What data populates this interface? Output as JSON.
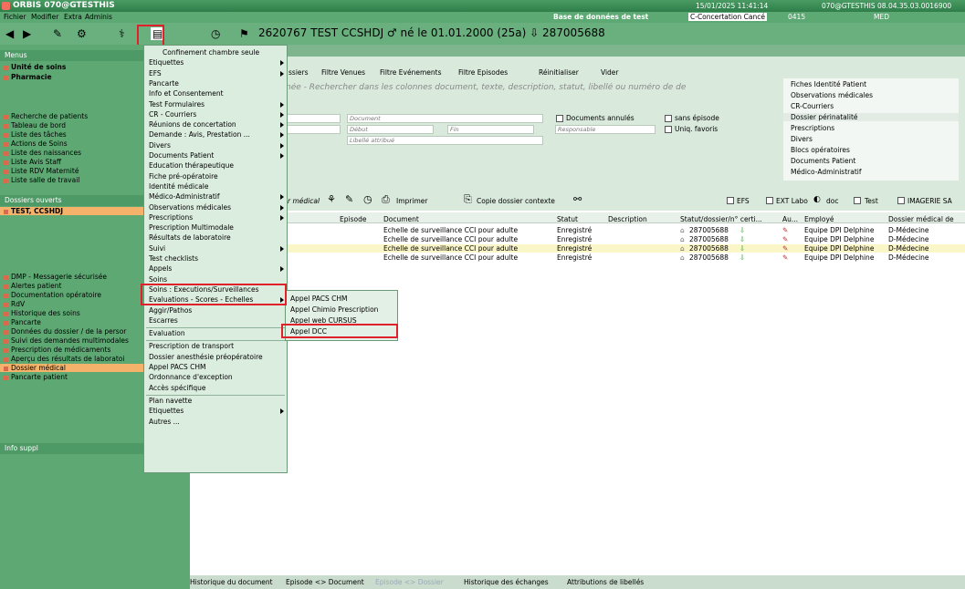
{
  "window": {
    "title": "ORBIS 070@GTESTHIS",
    "datetime": "15/01/2025 11:41:14",
    "session": "070@GTESTHIS 08.04.35.03.0016900"
  },
  "menubar": {
    "items": [
      "Fichier",
      "Modifier",
      "Extra",
      "Adminis"
    ],
    "db_label": "Base de données de test",
    "context": "C-Concertation Cancé",
    "code": "0415",
    "med": "MED"
  },
  "patient": {
    "text": "2620767  TEST CCSHDJ ♂ né le 01.01.2000  (25a)  ⇩ 287005688"
  },
  "left": {
    "menus_header": "Menus",
    "top_items": [
      "Unité de soins",
      "Pharmacie"
    ],
    "nav_items": [
      "Recherche de patients",
      "Tableau de bord",
      "Liste des tâches",
      "Actions de Soins",
      "Liste des naissances",
      "Liste Avis Staff",
      "Liste RDV Maternité",
      "Liste salle de travail"
    ],
    "dossiers_header": "Dossiers ouverts",
    "dossier": "TEST, CCSHDJ",
    "bottom_items": [
      "DMP - Messagerie sécurisée",
      "Alertes patient",
      "Documentation opératoire",
      "RdV",
      "Historique des soins",
      "Pancarte",
      "Données du dossier / de la persor",
      "Suivi des demandes multimodales",
      "Prescription de médicaments",
      "Aperçu des résultats de laboratoi",
      "Dossier médical",
      "Pancarte patient"
    ],
    "info_header": "Info suppl"
  },
  "tabs": [
    "ssiers",
    "Filtre Venues",
    "Filtre Evénements",
    "Filtre Episodes",
    "Réinitialiser",
    "Vider"
  ],
  "search_placeholder": "née - Rechercher dans les colonnes document, texte, description, statut, libellé ou numéro de de",
  "filters": {
    "document": "Document",
    "debut": "Début",
    "fin": "Fin",
    "libelle": "Libellé attribué",
    "responsable": "Responsable",
    "docs_annules": "Documents annulés",
    "sans_episode": "sans épisode",
    "uniq_favoris": "Uniq. favoris"
  },
  "side_list": [
    "Fiches Identité Patient",
    "Observations médicales",
    "CR-Courriers",
    "Dossier périnatalité",
    "Prescriptions",
    "Divers",
    "Blocs opératoires",
    "Documents Patient",
    "Médico-Administratif"
  ],
  "grid_toolbar": {
    "medical": "r médical",
    "imprimer": "Imprimer",
    "copie": "Copie dossier contexte",
    "efs": "EFS",
    "ext_labo": "EXT Labo",
    "doc": "doc",
    "test": "Test",
    "imagerie": "IMAGERIE SA"
  },
  "columns": [
    "Episode",
    "Document",
    "Statut",
    "Description",
    "Statut/dossier/n° certi...",
    "Au...",
    "Employé",
    "Dossier médical de"
  ],
  "rows": [
    {
      "document": "Echelle de surveillance CCI pour adulte",
      "statut": "Enregistré",
      "dossier": "287005688",
      "employe": "Equipe DPI Delphine",
      "dm": "D-Médecine"
    },
    {
      "document": "Echelle de surveillance CCI pour adulte",
      "statut": "Enregistré",
      "dossier": "287005688",
      "employe": "Equipe DPI Delphine",
      "dm": "D-Médecine"
    },
    {
      "document": "Echelle de surveillance CCI pour adulte",
      "statut": "Enregistré",
      "dossier": "287005688",
      "employe": "Equipe DPI Delphine",
      "dm": "D-Médecine"
    },
    {
      "document": "Echelle de surveillance CCI pour adulte",
      "statut": "Enregistré",
      "dossier": "287005688",
      "employe": "Equipe DPI Delphine",
      "dm": "D-Médecine"
    }
  ],
  "menu": {
    "items": [
      "Confinement chambre seule",
      "Etiquettes",
      "EFS",
      "Pancarte",
      "Info et Consentement",
      "Test Formulaires",
      "CR - Courriers",
      "Réunions de concertation",
      "Demande : Avis, Prestation ...",
      "Divers",
      "Documents Patient",
      "Education thérapeutique",
      "Fiche pré-opératoire",
      "Identité médicale",
      "Médico-Administratif",
      "Observations médicales",
      "Prescriptions",
      "Prescription Multimodale",
      "Résultats de laboratoire",
      "Suivi",
      "Test checklists",
      "Appels",
      "Soins",
      "Soins : Executions/Surveillances",
      "Evaluations - Scores - Echelles",
      "Aggir/Pathos",
      "Escarres",
      "Evaluation",
      "Prescription de transport",
      "Dossier anesthésie préopératoire",
      "Appel PACS CHM",
      "Ordonnance d'exception",
      "Accès spécifique",
      "Plan navette",
      "Etiquettes",
      "Autres ..."
    ]
  },
  "submenu": {
    "items": [
      "Appel PACS CHM",
      "Appel Chimio Prescription",
      "Appel web CURSUS",
      "Appel DCC"
    ]
  },
  "bottom_tabs": [
    "Historique du document",
    "Episode <> Document",
    "Episode <> Dossier",
    "Historique des échanges",
    "Attributions de libellés"
  ]
}
